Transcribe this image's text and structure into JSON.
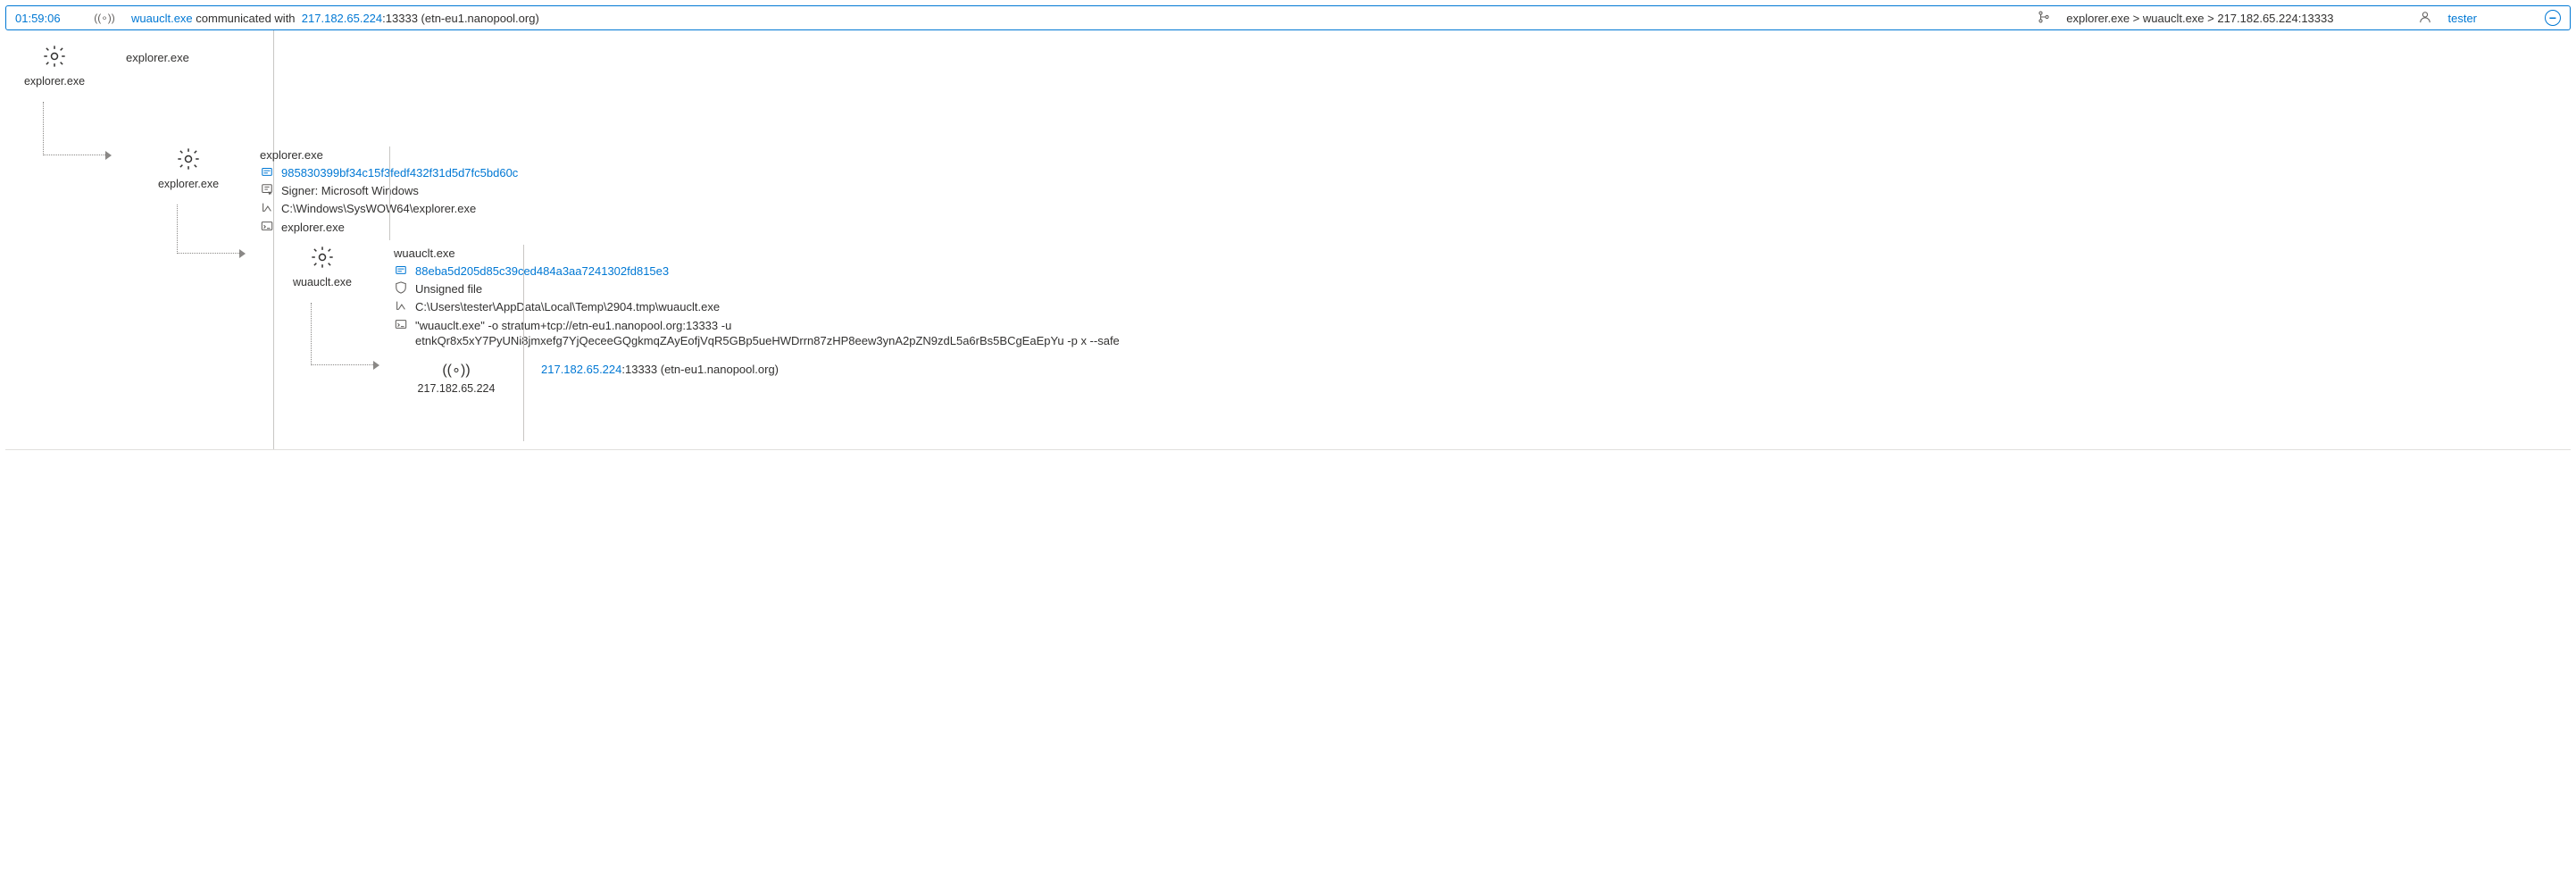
{
  "header": {
    "time": "01:59:06",
    "process": "wuauclt.exe",
    "action": " communicated with ",
    "ip": "217.182.65.224",
    "port_suffix": ":13333 (etn-eu1.nanopool.org)",
    "breadcrumb": "explorer.exe > wuauclt.exe > 217.182.65.224:13333",
    "user": "tester"
  },
  "tree": {
    "n1": {
      "label": "explorer.exe"
    },
    "n1_details": {
      "title": "explorer.exe"
    },
    "n2": {
      "label": "explorer.exe"
    },
    "n2_details": {
      "title": "explorer.exe",
      "sha": "985830399bf34c15f3fedf432f31d5d7fc5bd60c",
      "signer": "Signer: Microsoft Windows",
      "path": "C:\\Windows\\SysWOW64\\explorer.exe",
      "cmd": "explorer.exe"
    },
    "n3": {
      "label": "wuauclt.exe"
    },
    "n3_details": {
      "title": "wuauclt.exe",
      "sha": "88eba5d205d85c39ced484a3aa7241302fd815e3",
      "signer": "Unsigned file",
      "path": "C:\\Users\\tester\\AppData\\Local\\Temp\\2904.tmp\\wuauclt.exe",
      "cmd": "\"wuauclt.exe\" -o stratum+tcp://etn-eu1.nanopool.org:13333 -u etnkQr8x5xY7PyUNi8jmxefg7YjQeceeGQgkmqZAyEofjVqR5GBp5ueHWDrrn87zHP8eew3ynA2pZN9zdL5a6rBs5BCgEaEpYu -p x --safe"
    },
    "n4": {
      "label": "217.182.65.224"
    },
    "n4_details": {
      "ip": "217.182.65.224",
      "suffix": ":13333 (etn-eu1.nanopool.org)"
    }
  }
}
